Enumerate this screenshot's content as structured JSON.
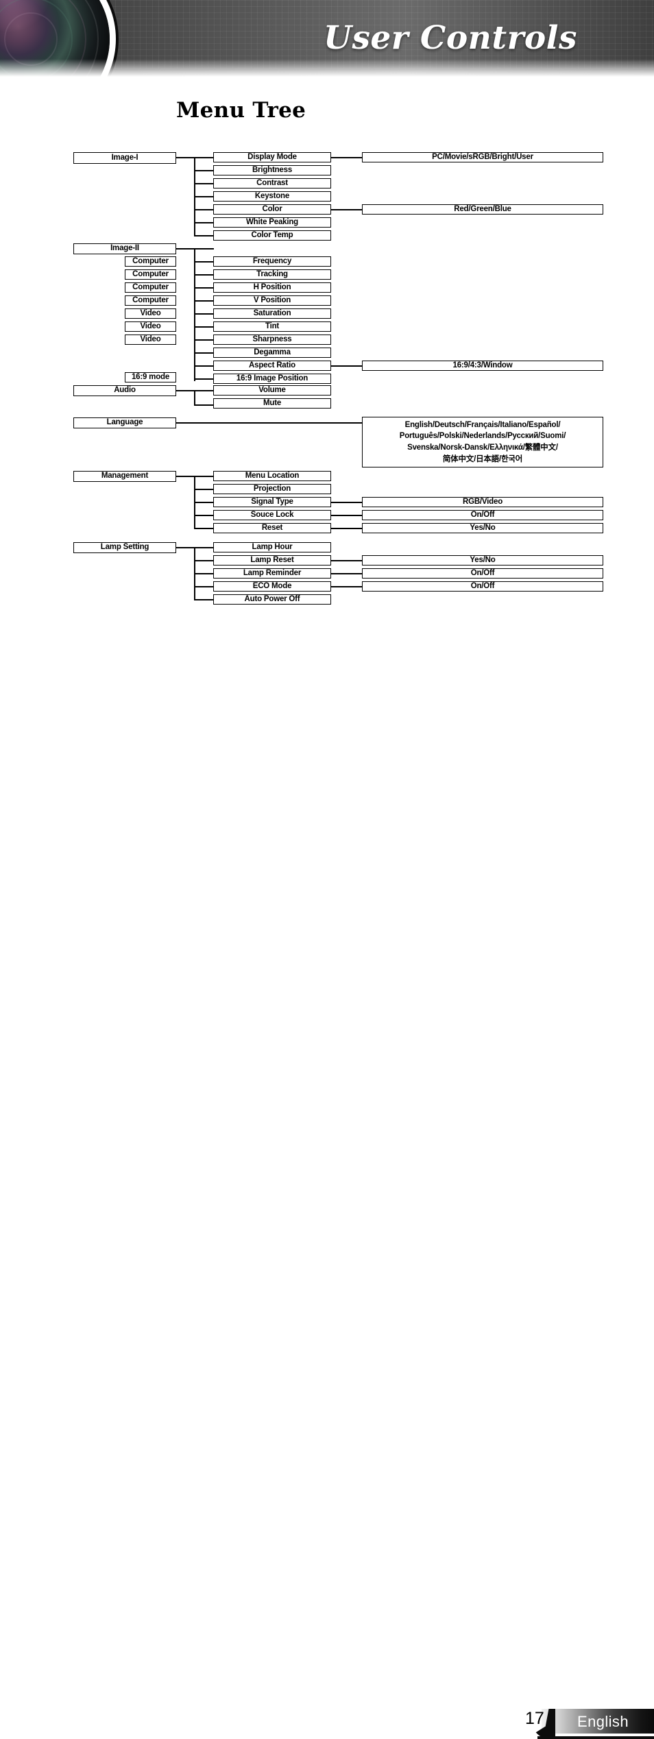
{
  "header": {
    "title": "User Controls",
    "lens_icon": "projector-lens-icon"
  },
  "page": {
    "title": "Menu Tree"
  },
  "footer": {
    "page_number": "17",
    "language_label": "English"
  },
  "diagram": {
    "type": "menu-tree",
    "root_menus": [
      {
        "label": "Image-I"
      },
      {
        "label": "Image-II"
      },
      {
        "label": "Audio"
      },
      {
        "label": "Language"
      },
      {
        "label": "Management"
      },
      {
        "label": "Lamp Setting"
      }
    ],
    "source_tags": [
      {
        "label": "Computer"
      },
      {
        "label": "Computer"
      },
      {
        "label": "Computer"
      },
      {
        "label": "Computer"
      },
      {
        "label": "Video"
      },
      {
        "label": "Video"
      },
      {
        "label": "Video"
      },
      {
        "label": "16:9 mode"
      }
    ],
    "items": [
      {
        "label": "Display Mode"
      },
      {
        "label": "Brightness"
      },
      {
        "label": "Contrast"
      },
      {
        "label": "Keystone"
      },
      {
        "label": "Color"
      },
      {
        "label": "White Peaking"
      },
      {
        "label": "Color Temp"
      },
      {
        "label": "Frequency"
      },
      {
        "label": "Tracking"
      },
      {
        "label": "H Position"
      },
      {
        "label": "V Position"
      },
      {
        "label": "Saturation"
      },
      {
        "label": "Tint"
      },
      {
        "label": "Sharpness"
      },
      {
        "label": "Degamma"
      },
      {
        "label": "Aspect Ratio"
      },
      {
        "label": "16:9 Image Position"
      },
      {
        "label": "Volume"
      },
      {
        "label": "Mute"
      },
      {
        "label": "Menu Location"
      },
      {
        "label": "Projection"
      },
      {
        "label": "Signal Type"
      },
      {
        "label": "Souce Lock"
      },
      {
        "label": "Reset"
      },
      {
        "label": "Lamp Hour"
      },
      {
        "label": "Lamp Reset"
      },
      {
        "label": "Lamp Reminder"
      },
      {
        "label": "ECO Mode"
      },
      {
        "label": "Auto Power Off"
      }
    ],
    "values": [
      {
        "label": "PC/Movie/sRGB/Bright/User"
      },
      {
        "label": "Red/Green/Blue"
      },
      {
        "label": "16:9/4:3/Window"
      },
      {
        "label": "RGB/Video"
      },
      {
        "label": "On/Off"
      },
      {
        "label": "Yes/No"
      },
      {
        "label": "Yes/No"
      },
      {
        "label": "On/Off"
      },
      {
        "label": "On/Off"
      }
    ],
    "language_value_lines": [
      "English/Deutsch/Français/Italiano/Español/",
      "Português/Polski/Nederlands/Русский/Suomi/",
      "Svenska/Norsk-Dansk/Ελληνικά/繁體中文/",
      "简体中文/日本語/한국어"
    ]
  }
}
